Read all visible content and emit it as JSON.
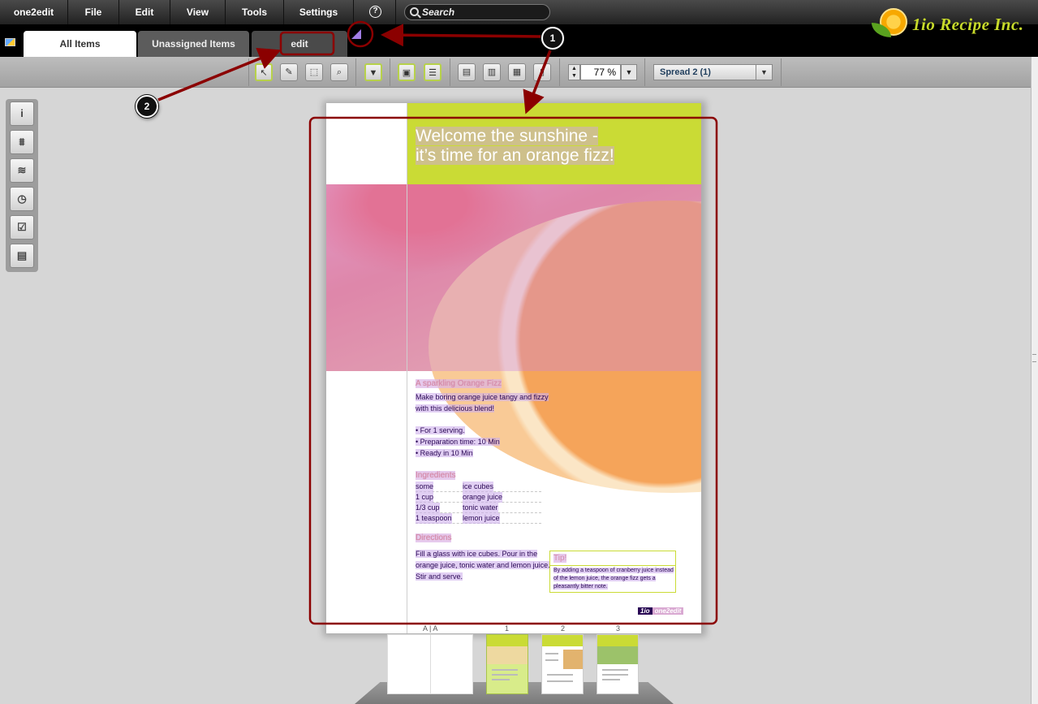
{
  "menubar": {
    "items": [
      "one2edit",
      "File",
      "Edit",
      "View",
      "Tools",
      "Settings"
    ],
    "help_icon": "question-circle-icon",
    "search_placeholder": "Search"
  },
  "tabs": {
    "all_items": "All Items",
    "unassigned_items": "Unassigned Items",
    "edit": "edit"
  },
  "logo": {
    "text": "1io Recipe Inc."
  },
  "toolbar": {
    "zoom": "77 %",
    "spread": "Spread 2 (1)"
  },
  "document": {
    "headline_line1": "Welcome the sunshine -",
    "headline_line2": "it’s time for an orange fizz!",
    "subtitle": "A sparkling Orange Fizz",
    "intro_line1": "Make boring orange juice tangy and fizzy",
    "intro_line2": "with this delicious blend!",
    "bullets": [
      "• For 1 serving.",
      "• Preparation time: 10 Min",
      "• Ready in 10 Min"
    ],
    "ingredients_title": "Ingredients",
    "ingredients": [
      {
        "qty": "some",
        "item": "ice cubes"
      },
      {
        "qty": "1 cup",
        "item": "orange juice"
      },
      {
        "qty": "1/3 cup",
        "item": "tonic water"
      },
      {
        "qty": "1 teaspoon",
        "item": "lemon juice"
      }
    ],
    "directions_title": "Directions",
    "directions": [
      "Fill a glass with ice cubes. Pour in the",
      "orange juice, tonic water and lemon juice.",
      "Stir and serve."
    ],
    "tip_title": "Tip!",
    "tip_text": "By adding a teaspoon of cranberry juice instead of the lemon juice, the orange fizz gets a pleasantly bitter note.",
    "footer_logo_a": "1io",
    "footer_logo_b": "one2edit"
  },
  "page_strip": {
    "label_a": "A | A",
    "label_1": "1",
    "label_2": "2",
    "label_3": "3"
  },
  "annotations": {
    "callout_1": "1",
    "callout_2": "2"
  },
  "colors": {
    "accent_green": "#cadb35",
    "annotation_red": "#8b0000",
    "marker_purple": "#a27ee6"
  }
}
